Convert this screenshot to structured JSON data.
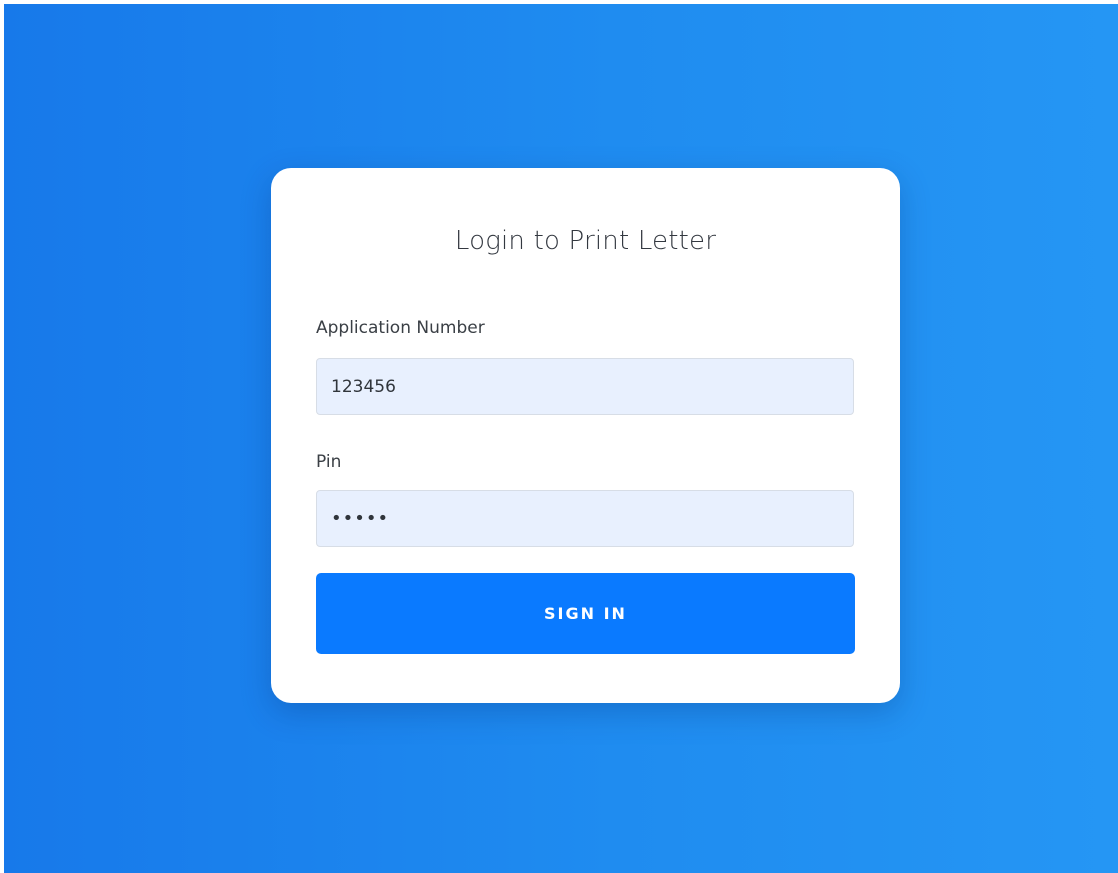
{
  "login": {
    "title": "Login to Print Letter",
    "application_number_label": "Application Number",
    "application_number_value": "123456",
    "pin_label": "Pin",
    "pin_value": "•••••",
    "sign_in_label": "SIGN IN"
  },
  "colors": {
    "background_start": "#1779ea",
    "background_end": "#2596f4",
    "card": "#ffffff",
    "field_fill": "#e8f0fe",
    "button": "#0a7aff"
  }
}
